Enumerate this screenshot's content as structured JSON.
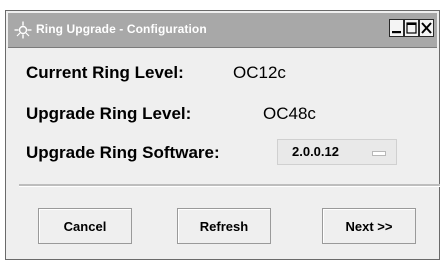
{
  "window": {
    "title": "Ring Upgrade - Configuration",
    "title_icon": "ring-icon",
    "controls": [
      "minimize-icon",
      "maximize-icon",
      "close-icon"
    ]
  },
  "form": {
    "current_level_label": "Current Ring Level:",
    "current_level_value": "OC12c",
    "upgrade_level_label": "Upgrade Ring Level:",
    "upgrade_level_value": "OC48c",
    "software_label": "Upgrade Ring Software:",
    "software_selected": "2.0.0.12"
  },
  "buttons": {
    "cancel": "Cancel",
    "refresh": "Refresh",
    "next": "Next >>"
  },
  "colors": {
    "titlebar": "#a8a8a8",
    "title_text": "#ffffff",
    "window_bg": "#efefef"
  }
}
